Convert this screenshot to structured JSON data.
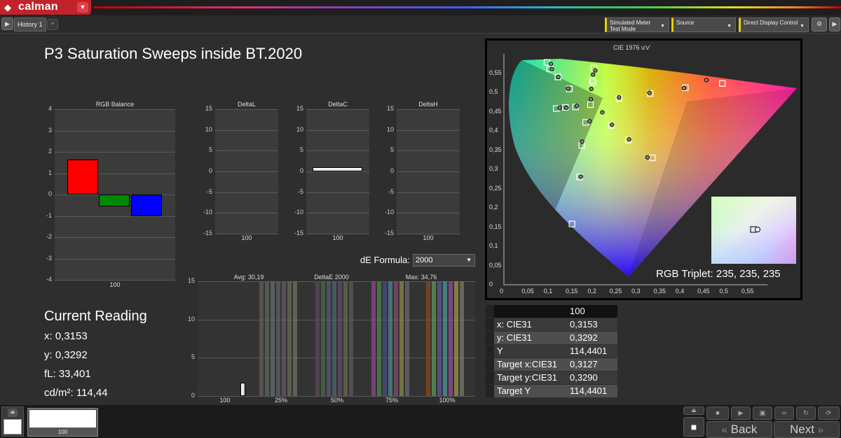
{
  "app": {
    "logo_text": "calman"
  },
  "tabs": {
    "history_label": "History 1",
    "add_label": "+"
  },
  "toolbar": {
    "meter_label": "Simulated Meter",
    "meter_value": "Test Mode",
    "source_label": "Source",
    "display_label": "Direct Display Control"
  },
  "page": {
    "title": "P3 Saturation Sweeps inside BT.2020"
  },
  "rgb_balance": {
    "title": "RGB Balance",
    "ticks": [
      "4",
      "3",
      "2",
      "1",
      "0",
      "-1",
      "-2",
      "-3",
      "-4"
    ],
    "xlabel": "100",
    "colors": {
      "red": "#ff0000",
      "green": "#008a00",
      "blue": "#0000ff"
    }
  },
  "delta_panels": [
    {
      "title": "DeltaL",
      "ticks": [
        "15",
        "10",
        "5",
        "0",
        "-5",
        "-10",
        "-15"
      ],
      "xlabel": "100"
    },
    {
      "title": "DeltaC",
      "ticks": [
        "15",
        "10",
        "5",
        "0",
        "-5",
        "-10",
        "-15"
      ],
      "xlabel": "100"
    },
    {
      "title": "DeltaH",
      "ticks": [
        "15",
        "10",
        "5",
        "0",
        "-5",
        "-10",
        "-15"
      ],
      "xlabel": "100"
    }
  ],
  "formula": {
    "label": "dE Formula:",
    "value": "2000"
  },
  "deltae": {
    "title": "DeltaE 2000",
    "avg": "Avg: 30,19",
    "max": "Max: 34,76",
    "ticks": [
      "15",
      "10",
      "5",
      "0"
    ],
    "xlabels": [
      "100",
      "25%",
      "50%",
      "75%",
      "100%"
    ]
  },
  "reading": {
    "title": "Current Reading",
    "x": "x: 0,3153",
    "y": "y: 0,3292",
    "fl": "fL: 33,401",
    "cd": "cd/m²: 114,44"
  },
  "table": {
    "header": "100",
    "rows": [
      {
        "k": "x: CIE31",
        "v": "0,3153"
      },
      {
        "k": "y: CIE31",
        "v": "0,3292"
      },
      {
        "k": "Y",
        "v": "114,4401"
      },
      {
        "k": "Target x:CIE31",
        "v": "0,3127"
      },
      {
        "k": "Target y:CIE31",
        "v": "0,3290"
      },
      {
        "k": "Target Y",
        "v": "114,4401"
      }
    ]
  },
  "cie": {
    "title": "CIE 1976 u'v'",
    "yticks": [
      "0,55",
      "0,5",
      "0,45",
      "0,4",
      "0,35",
      "0,3",
      "0,25",
      "0,2",
      "0,15",
      "0,1",
      "0,05",
      "0"
    ],
    "xticks": [
      "0",
      "0,05",
      "0,1",
      "0,15",
      "0,2",
      "0,25",
      "0,3",
      "0,35",
      "0,4",
      "0,45",
      "0,5",
      "0,55"
    ],
    "triplet": "RGB Triplet: 235, 235, 235"
  },
  "bottom": {
    "swatch_label": "100",
    "back_label": "Back",
    "next_label": "Next"
  },
  "chart_data": [
    {
      "type": "bar",
      "title": "RGB Balance",
      "categories": [
        "100"
      ],
      "series": [
        {
          "name": "R",
          "values": [
            1.65
          ]
        },
        {
          "name": "G",
          "values": [
            -0.55
          ]
        },
        {
          "name": "B",
          "values": [
            -1.0
          ]
        }
      ],
      "ylim": [
        -4,
        4
      ]
    },
    {
      "type": "bar",
      "title": "DeltaC",
      "categories": [
        "100"
      ],
      "values": [
        1.0
      ],
      "ylim": [
        -15,
        15
      ]
    },
    {
      "type": "bar",
      "title": "DeltaE 2000",
      "categories": [
        "100",
        "25%",
        "50%",
        "75%",
        "100%"
      ],
      "values": [
        1.7
      ],
      "ylim": [
        0,
        15
      ]
    },
    {
      "type": "scatter",
      "title": "CIE 1976 u'v'",
      "xlim": [
        0,
        0.6
      ],
      "ylim": [
        0,
        0.6
      ],
      "series": [
        {
          "name": "targets",
          "points": [
            [
              0.098,
              0.578
            ],
            [
              0.104,
              0.561
            ],
            [
              0.123,
              0.54
            ],
            [
              0.149,
              0.509
            ],
            [
              0.119,
              0.458
            ],
            [
              0.14,
              0.461
            ],
            [
              0.163,
              0.462
            ],
            [
              0.205,
              0.563
            ],
            [
              0.201,
              0.531
            ],
            [
              0.203,
              0.526
            ],
            [
              0.197,
              0.468
            ],
            [
              0.186,
              0.422
            ],
            [
              0.177,
              0.362
            ],
            [
              0.172,
              0.28
            ],
            [
              0.155,
              0.158
            ],
            [
              0.262,
              0.484
            ],
            [
              0.333,
              0.497
            ],
            [
              0.413,
              0.512
            ],
            [
              0.497,
              0.523
            ],
            [
              0.244,
              0.414
            ],
            [
              0.283,
              0.376
            ],
            [
              0.338,
              0.33
            ]
          ]
        },
        {
          "name": "measured",
          "points": [
            [
              0.107,
              0.574
            ],
            [
              0.109,
              0.56
            ],
            [
              0.124,
              0.54
            ],
            [
              0.146,
              0.51
            ],
            [
              0.127,
              0.46
            ],
            [
              0.142,
              0.46
            ],
            [
              0.166,
              0.465
            ],
            [
              0.208,
              0.557
            ],
            [
              0.203,
              0.546
            ],
            [
              0.199,
              0.509
            ],
            [
              0.198,
              0.482
            ],
            [
              0.195,
              0.425
            ],
            [
              0.178,
              0.372
            ],
            [
              0.175,
              0.281
            ],
            [
              0.224,
              0.448
            ],
            [
              0.262,
              0.487
            ],
            [
              0.331,
              0.499
            ],
            [
              0.41,
              0.511
            ],
            [
              0.461,
              0.532
            ],
            [
              0.246,
              0.416
            ],
            [
              0.285,
              0.378
            ],
            [
              0.327,
              0.331
            ]
          ]
        }
      ]
    }
  ]
}
